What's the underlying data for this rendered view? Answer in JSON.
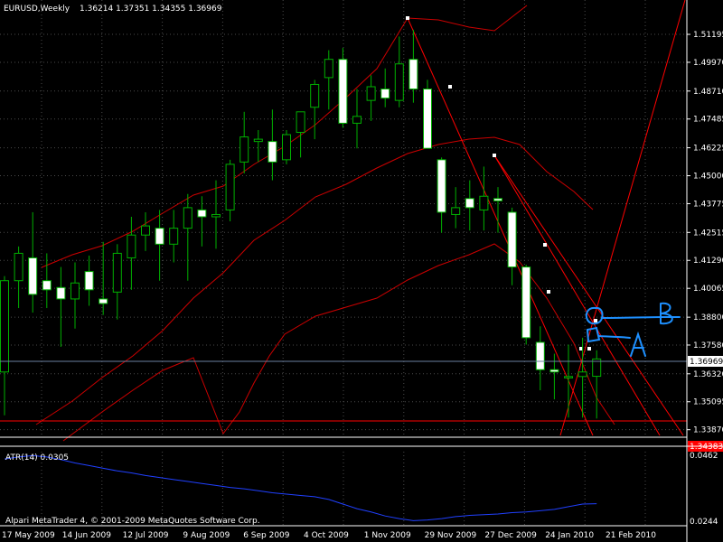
{
  "header": {
    "symbol": "EURUSD,Weekly",
    "ohlc": "1.36214 1.37351 1.34355 1.36969"
  },
  "atr": {
    "label": "ATR(14) 0.0305",
    "max_label": "0.0462",
    "min_label": "0.0244"
  },
  "copyright": "Alpari MetaTrader 4, © 2001-2009 MetaQuotes Software Corp.",
  "colors": {
    "background": "#000000",
    "grid": "#4a4a4a",
    "bull_candle": "#00b000",
    "bear_candle": "#ffffff",
    "bollinger": "#cc0000",
    "trendline": "#ff0000",
    "atr_line": "#2040ff",
    "annotation": "#1e90ff",
    "price_line": "#6a7fa0"
  },
  "annotations": {
    "upper_marker": "B",
    "lower_marker": "A"
  },
  "chart_data": {
    "type": "candlestick",
    "title": "EURUSD,Weekly",
    "x_tick_labels": [
      "17 May 2009",
      "14 Jun 2009",
      "12 Jul 2009",
      "9 Aug 2009",
      "6 Sep 2009",
      "4 Oct 2009",
      "1 Nov 2009",
      "29 Nov 2009",
      "27 Dec 2009",
      "24 Jan 2010",
      "21 Feb 2010"
    ],
    "y_tick_labels": [
      "1.51195",
      "1.49970",
      "1.48710",
      "1.47485",
      "1.46225",
      "1.45000",
      "1.43775",
      "1.42515",
      "1.41290",
      "1.40065",
      "1.38800",
      "1.37580",
      "1.36320",
      "1.35095",
      "1.33870"
    ],
    "ylim": [
      1.3362,
      1.5175
    ],
    "current_price": "1.36969",
    "support_price": "1.34383",
    "candles": [
      {
        "open": 1.364,
        "high": 1.406,
        "low": 1.345,
        "close": 1.404
      },
      {
        "open": 1.404,
        "high": 1.419,
        "low": 1.392,
        "close": 1.416
      },
      {
        "open": 1.414,
        "high": 1.434,
        "low": 1.39,
        "close": 1.398
      },
      {
        "open": 1.404,
        "high": 1.416,
        "low": 1.392,
        "close": 1.4
      },
      {
        "open": 1.401,
        "high": 1.41,
        "low": 1.375,
        "close": 1.396
      },
      {
        "open": 1.396,
        "high": 1.412,
        "low": 1.383,
        "close": 1.403
      },
      {
        "open": 1.408,
        "high": 1.415,
        "low": 1.393,
        "close": 1.4
      },
      {
        "open": 1.396,
        "high": 1.421,
        "low": 1.389,
        "close": 1.394
      },
      {
        "open": 1.399,
        "high": 1.42,
        "low": 1.387,
        "close": 1.416
      },
      {
        "open": 1.414,
        "high": 1.432,
        "low": 1.4,
        "close": 1.424
      },
      {
        "open": 1.424,
        "high": 1.434,
        "low": 1.417,
        "close": 1.428
      },
      {
        "open": 1.427,
        "high": 1.435,
        "low": 1.404,
        "close": 1.42
      },
      {
        "open": 1.42,
        "high": 1.435,
        "low": 1.412,
        "close": 1.427
      },
      {
        "open": 1.427,
        "high": 1.442,
        "low": 1.404,
        "close": 1.436
      },
      {
        "open": 1.435,
        "high": 1.441,
        "low": 1.419,
        "close": 1.432
      },
      {
        "open": 1.432,
        "high": 1.448,
        "low": 1.418,
        "close": 1.433
      },
      {
        "open": 1.435,
        "high": 1.457,
        "low": 1.43,
        "close": 1.455
      },
      {
        "open": 1.456,
        "high": 1.478,
        "low": 1.451,
        "close": 1.467
      },
      {
        "open": 1.465,
        "high": 1.47,
        "low": 1.456,
        "close": 1.466
      },
      {
        "open": 1.465,
        "high": 1.479,
        "low": 1.448,
        "close": 1.456
      },
      {
        "open": 1.457,
        "high": 1.47,
        "low": 1.455,
        "close": 1.468
      },
      {
        "open": 1.469,
        "high": 1.478,
        "low": 1.458,
        "close": 1.478
      },
      {
        "open": 1.48,
        "high": 1.492,
        "low": 1.466,
        "close": 1.49
      },
      {
        "open": 1.493,
        "high": 1.505,
        "low": 1.479,
        "close": 1.501
      },
      {
        "open": 1.501,
        "high": 1.506,
        "low": 1.471,
        "close": 1.473
      },
      {
        "open": 1.473,
        "high": 1.488,
        "low": 1.462,
        "close": 1.476
      },
      {
        "open": 1.483,
        "high": 1.494,
        "low": 1.474,
        "close": 1.489
      },
      {
        "open": 1.488,
        "high": 1.497,
        "low": 1.48,
        "close": 1.484
      },
      {
        "open": 1.483,
        "high": 1.511,
        "low": 1.48,
        "close": 1.499
      },
      {
        "open": 1.501,
        "high": 1.514,
        "low": 1.482,
        "close": 1.488
      },
      {
        "open": 1.488,
        "high": 1.492,
        "low": 1.462,
        "close": 1.462
      },
      {
        "open": 1.457,
        "high": 1.458,
        "low": 1.425,
        "close": 1.434
      },
      {
        "open": 1.433,
        "high": 1.445,
        "low": 1.427,
        "close": 1.436
      },
      {
        "open": 1.44,
        "high": 1.448,
        "low": 1.426,
        "close": 1.436
      },
      {
        "open": 1.435,
        "high": 1.454,
        "low": 1.426,
        "close": 1.441
      },
      {
        "open": 1.44,
        "high": 1.445,
        "low": 1.425,
        "close": 1.439
      },
      {
        "open": 1.434,
        "high": 1.436,
        "low": 1.402,
        "close": 1.41
      },
      {
        "open": 1.41,
        "high": 1.411,
        "low": 1.376,
        "close": 1.379
      },
      {
        "open": 1.377,
        "high": 1.384,
        "low": 1.356,
        "close": 1.365
      },
      {
        "open": 1.365,
        "high": 1.372,
        "low": 1.352,
        "close": 1.364
      },
      {
        "open": 1.362,
        "high": 1.376,
        "low": 1.344,
        "close": 1.362
      },
      {
        "open": 1.362,
        "high": 1.379,
        "low": 1.344,
        "close": 1.364
      },
      {
        "open": 1.3621,
        "high": 1.3735,
        "low": 1.3436,
        "close": 1.3697
      }
    ],
    "atr_series": {
      "name": "ATR(14)",
      "range": [
        0.0244,
        0.0462
      ],
      "values": [
        0.044,
        0.0446,
        0.045,
        0.0446,
        0.0438,
        0.0428,
        0.042,
        0.0412,
        0.0404,
        0.0398,
        0.039,
        0.0384,
        0.0378,
        0.0372,
        0.0366,
        0.036,
        0.0354,
        0.035,
        0.0344,
        0.0338,
        0.0334,
        0.033,
        0.0326,
        0.0318,
        0.0304,
        0.029,
        0.028,
        0.0268,
        0.026,
        0.0254,
        0.0256,
        0.026,
        0.0266,
        0.027,
        0.0272,
        0.0274,
        0.0278,
        0.028,
        0.0284,
        0.0288,
        0.0296,
        0.0304,
        0.0305
      ]
    },
    "grid": true
  }
}
